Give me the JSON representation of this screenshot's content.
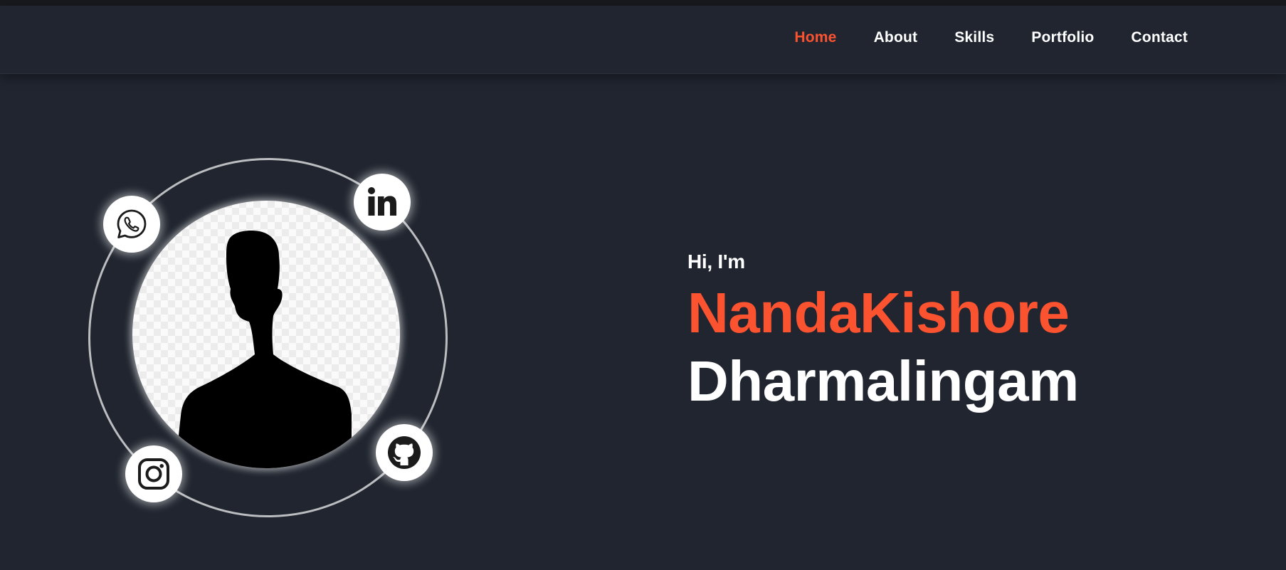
{
  "nav": {
    "items": [
      {
        "label": "Home",
        "active": true
      },
      {
        "label": "About",
        "active": false
      },
      {
        "label": "Skills",
        "active": false
      },
      {
        "label": "Portfolio",
        "active": false
      },
      {
        "label": "Contact",
        "active": false
      }
    ]
  },
  "hero": {
    "greeting": "Hi, I'm",
    "first_name": "NandaKishore",
    "last_name": "Dharmalingam"
  },
  "social": {
    "icons": [
      "whatsapp-icon",
      "linkedin-icon",
      "instagram-icon",
      "github-icon"
    ]
  },
  "colors": {
    "background": "#20252f",
    "accent": "#fb5230",
    "text": "#ffffff"
  }
}
